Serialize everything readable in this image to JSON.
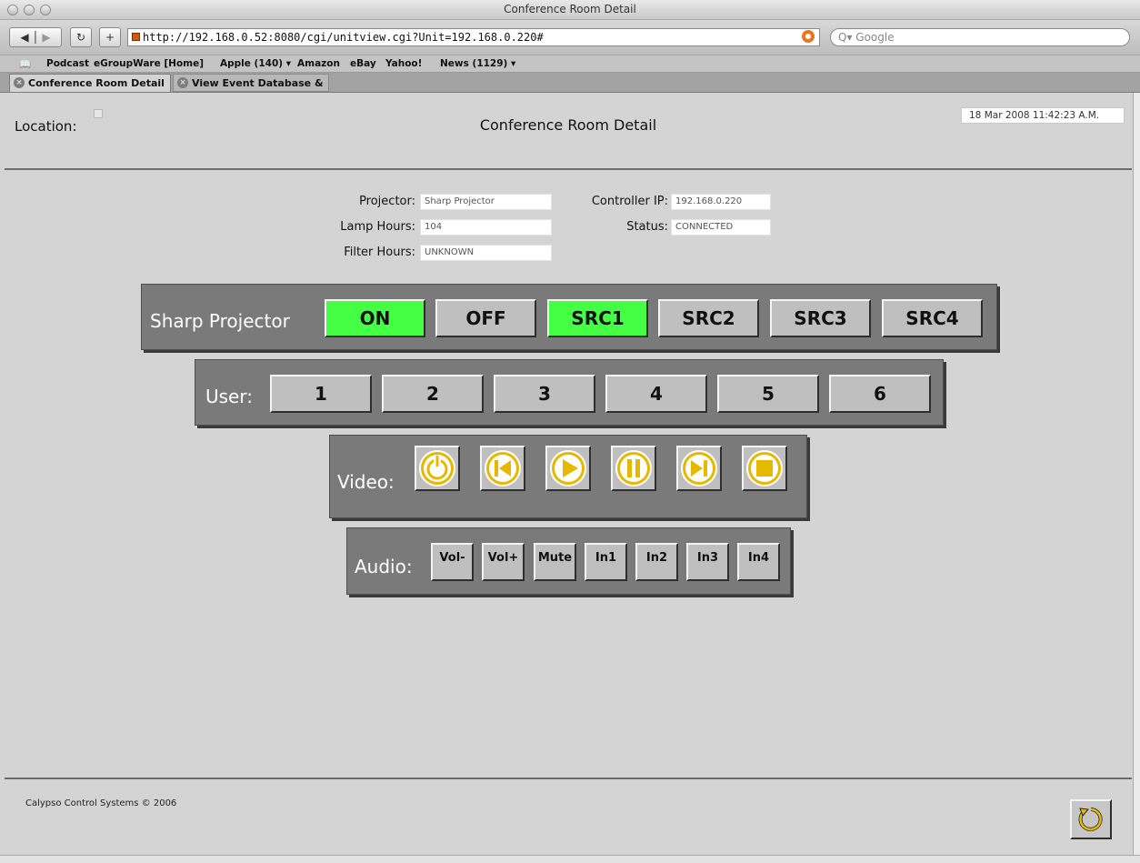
{
  "browser": {
    "window_title": "Conference Room Detail",
    "url": "http://192.168.0.52:8080/cgi/unitview.cgi?Unit=192.168.0.220#",
    "search_placeholder": "Q▾ Google",
    "bookmarks": [
      "Podcast",
      "eGroupWare [Home]",
      "Apple (140) ▾",
      "Amazon",
      "eBay",
      "Yahoo!",
      "News (1129) ▾"
    ],
    "tabs": [
      {
        "label": "Conference Room Detail",
        "active": true
      },
      {
        "label": "View Event Database & ...",
        "active": false
      }
    ]
  },
  "header": {
    "location_label": "Location:",
    "title": "Conference Room Detail",
    "datetime": "18 Mar 2008 11:42:23 A.M."
  },
  "info": {
    "projector_label": "Projector:",
    "projector_value": "Sharp Projector",
    "lamp_hours_label": "Lamp Hours:",
    "lamp_hours_value": "104",
    "filter_hours_label": "Filter Hours:",
    "filter_hours_value": "UNKNOWN",
    "controller_ip_label": "Controller IP:",
    "controller_ip_value": "192.168.0.220",
    "status_label": "Status:",
    "status_value": "CONNECTED"
  },
  "projector_panel": {
    "label": "Sharp Projector",
    "buttons": [
      {
        "label": "ON",
        "active": true
      },
      {
        "label": "OFF",
        "active": false
      },
      {
        "label": "SRC1",
        "active": true
      },
      {
        "label": "SRC2",
        "active": false
      },
      {
        "label": "SRC3",
        "active": false
      },
      {
        "label": "SRC4",
        "active": false
      }
    ]
  },
  "user_panel": {
    "label": "User:",
    "buttons": [
      "1",
      "2",
      "3",
      "4",
      "5",
      "6"
    ]
  },
  "video_panel": {
    "label": "Video:",
    "buttons": [
      "power-icon",
      "skip-back-icon",
      "play-icon",
      "pause-icon",
      "skip-forward-icon",
      "stop-icon"
    ]
  },
  "audio_panel": {
    "label": "Audio:",
    "buttons": [
      "Vol-",
      "Vol+",
      "Mute",
      "In1",
      "In2",
      "In3",
      "In4"
    ]
  },
  "footer": {
    "copyright": "Calypso Control Systems © 2006"
  },
  "colors": {
    "active_green": "#44ff44",
    "icon_gold": "#e6b800",
    "panel_gray": "#7a7a7a",
    "page_bg": "#d4d4d4"
  }
}
